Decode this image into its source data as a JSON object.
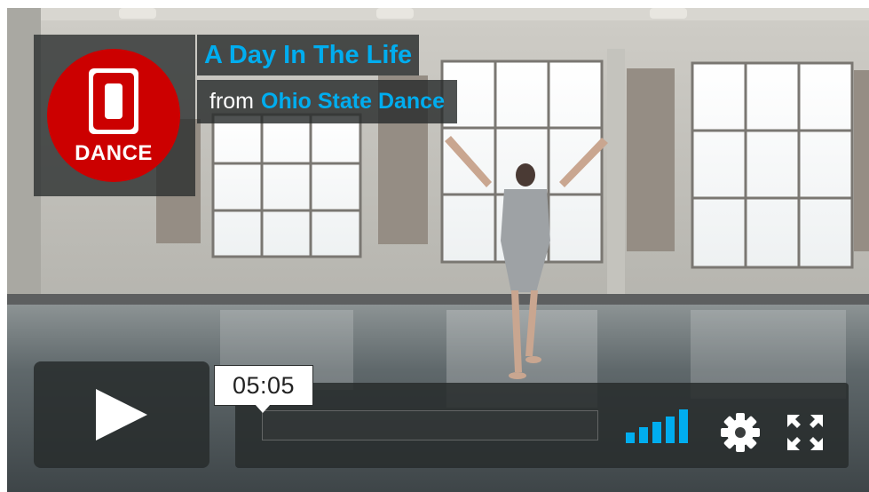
{
  "video": {
    "title": "A Day In The Life",
    "byline_prefix": "from",
    "channel": "Ohio State Dance"
  },
  "logo": {
    "letter": "O",
    "text": "DANCE",
    "circle_color": "#cc0000",
    "icon": "ohio-state-block-o-logo"
  },
  "player": {
    "timestamp": "05:05",
    "accent_color": "#00adef",
    "icons": {
      "play": "play-icon",
      "volume": "volume-bars-icon",
      "settings": "gear-icon",
      "fullscreen": "fullscreen-icon"
    }
  }
}
